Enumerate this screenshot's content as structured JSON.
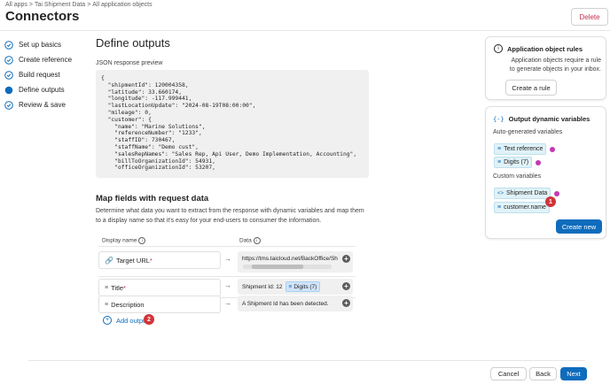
{
  "breadcrumb": [
    "All apps",
    "Tai Shipment Data",
    "All application objects"
  ],
  "breadcrumb_separator": ">",
  "page_title": "Connectors",
  "delete_label": "Delete",
  "steps": [
    {
      "label": "Set up basics",
      "state": "done"
    },
    {
      "label": "Create reference",
      "state": "done"
    },
    {
      "label": "Build request",
      "state": "done"
    },
    {
      "label": "Define outputs",
      "state": "current"
    },
    {
      "label": "Review & save",
      "state": "done"
    }
  ],
  "main": {
    "title": "Define outputs",
    "json_label": "JSON response preview",
    "json_lines": [
      "{",
      "  \"shipmentId\": 120004358,",
      "  \"latitude\": 33.660174,",
      "  \"longitude\": -117.999441,",
      "  \"lastLocationUpdate\": \"2024-08-19T08:00:00\",",
      "  \"mileage\": 0,",
      "  \"customer\": {",
      "    \"name\": \"Marine Solutions\",",
      "    \"referenceNumber\": \"1233\",",
      "    \"staffID\": 730467,",
      "    \"staffName\": \"Demo cust\",",
      "    \"salesRepNames\": \"Sales Rep, Api User, Demo Implementation, Accounting\",",
      "    \"billToOrganizationId\": 54931,",
      "    \"officeOrganizationId\": 53207,"
    ],
    "map_title": "Map fields with request data",
    "map_desc": "Determine what data you want to extract from the response with dynamic variables and map them to a display name so that it's easy for your end-users to consumer the information.",
    "col_display_name": "Display name",
    "col_data": "Data",
    "rows": [
      {
        "name": "Target URL",
        "required": true,
        "icon": "link-icon",
        "data_text": "https://tms.taicloud.net/BackOffice/Sh",
        "data_chip": ""
      },
      {
        "name": "Title",
        "required": true,
        "icon": "text-lines-icon",
        "data_text": "Shipment Id: 12",
        "data_chip": "Digits (7)"
      },
      {
        "name": "Description",
        "required": false,
        "icon": "text-lines-icon",
        "data_text": "A Shipment Id has been detected.",
        "data_chip": ""
      }
    ],
    "add_output_label": "Add output",
    "badge_2": "2"
  },
  "rules_card": {
    "title": "Application object rules",
    "text": "Application objects require a rule to generate objects in your inbox.",
    "button": "Create a rule"
  },
  "vars_card": {
    "title": "Output dynamic variables",
    "auto_label": "Auto-generated variables",
    "auto_vars": [
      "Text reference",
      "Digits (7)"
    ],
    "custom_label": "Custom variables",
    "custom_vars": [
      "Shipment Data",
      "customer.name"
    ],
    "badge_1": "1",
    "create_button": "Create new"
  },
  "footer": {
    "cancel": "Cancel",
    "back": "Back",
    "next": "Next"
  },
  "colors": {
    "accent": "#0f6cbd",
    "danger": "#c4314b",
    "badge": "#d13438",
    "magenta_dot": "#c239b3"
  }
}
